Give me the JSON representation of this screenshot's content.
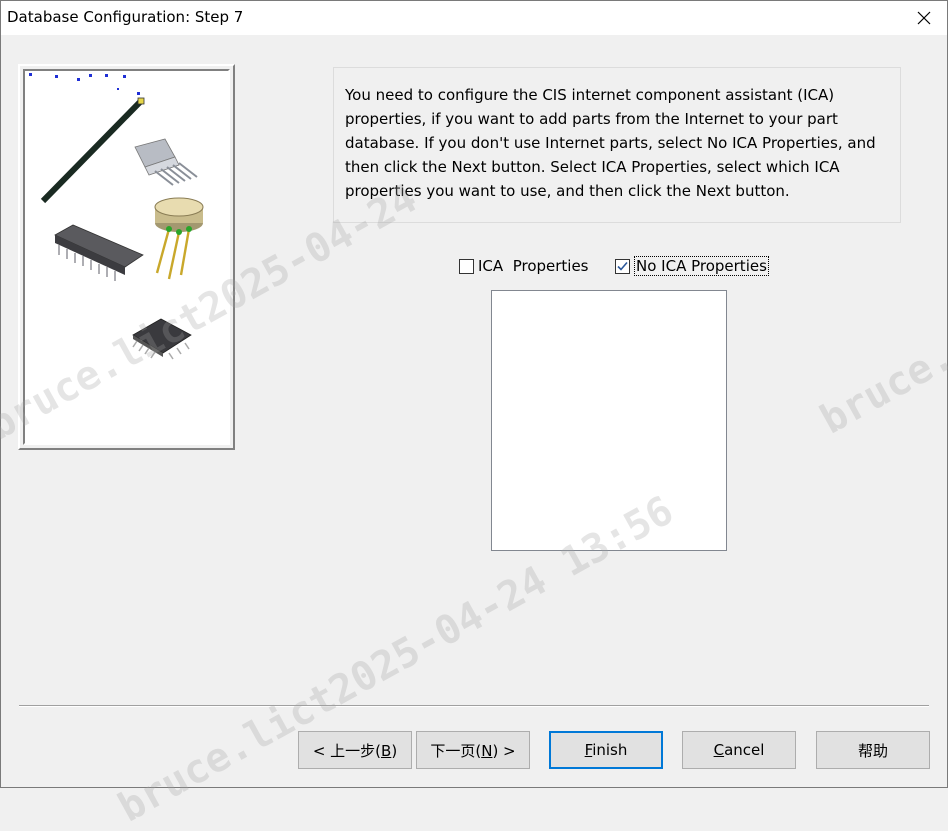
{
  "window": {
    "title": "Database Configuration: Step 7",
    "close_icon": "close-icon"
  },
  "description": "You need to configure the CIS internet component assistant (ICA) properties, if you want to add parts from the Internet to your part database. If you don't use Internet parts, select No ICA Properties, and then click the Next button. Select ICA Properties, select which ICA properties you want to use, and then click the Next button.",
  "options": {
    "ica_properties": {
      "label": "ICA  Properties",
      "checked": false
    },
    "no_ica_properties": {
      "label": "No ICA Properties",
      "checked": true
    }
  },
  "buttons": {
    "back": {
      "pre": "< 上一步(",
      "key": "B",
      "post": ")"
    },
    "next": {
      "pre": "下一页(",
      "key": "N",
      "post": ") >"
    },
    "finish": {
      "key": "F",
      "rest": "inish"
    },
    "cancel": {
      "key": "C",
      "rest": "ancel"
    },
    "help": {
      "label": "帮助"
    }
  },
  "watermarks": [
    "bruce.lict2025-04-24 13:56",
    "bruce.",
    "bruce.lict2025-04-24"
  ],
  "colors": {
    "accent": "#0078d7",
    "checkmark": "#2b579a"
  }
}
